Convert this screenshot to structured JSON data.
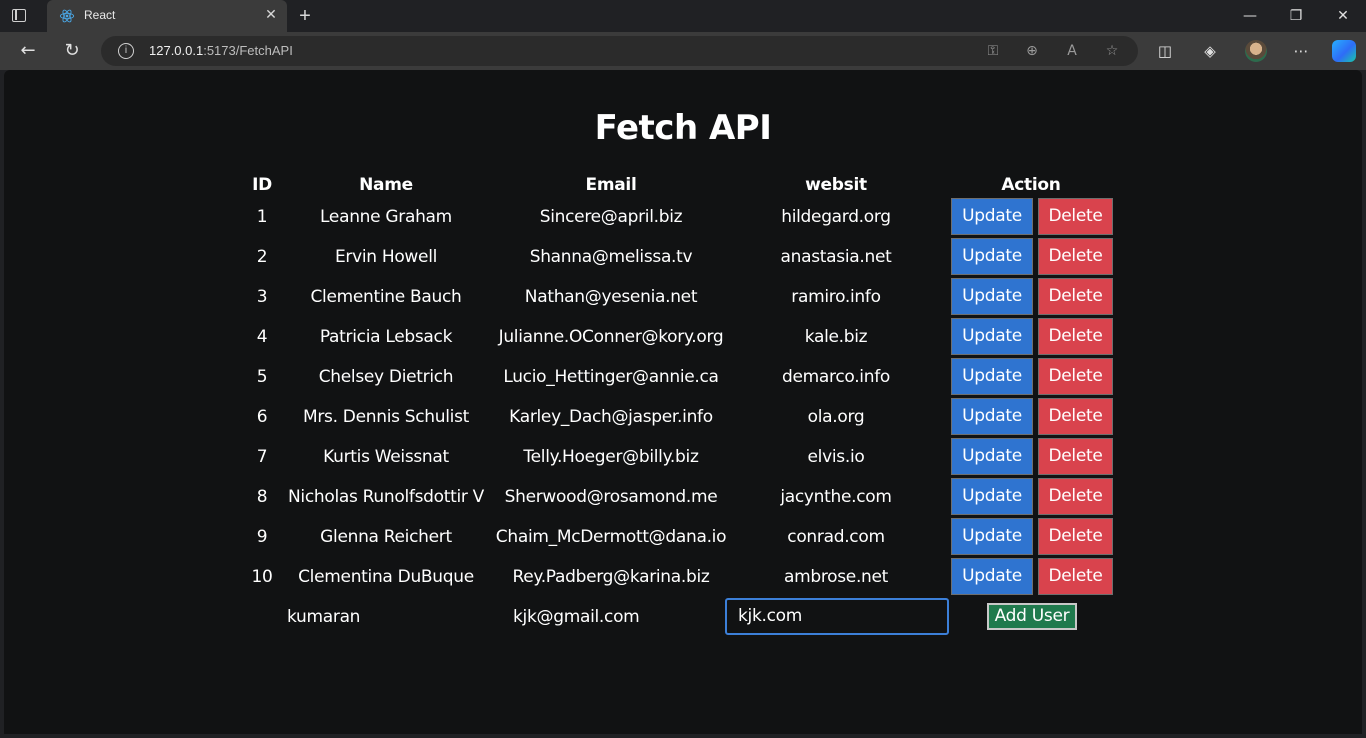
{
  "browser": {
    "tab_title": "React",
    "url_host": "127.0.0.1",
    "url_rest": ":5173/FetchAPI"
  },
  "page": {
    "title": "Fetch API",
    "headers": [
      "ID",
      "Name",
      "Email",
      "websit",
      "Action"
    ],
    "rows": [
      {
        "id": "1",
        "name": "Leanne Graham",
        "email": "Sincere@april.biz",
        "website": "hildegard.org"
      },
      {
        "id": "2",
        "name": "Ervin Howell",
        "email": "Shanna@melissa.tv",
        "website": "anastasia.net"
      },
      {
        "id": "3",
        "name": "Clementine Bauch",
        "email": "Nathan@yesenia.net",
        "website": "ramiro.info"
      },
      {
        "id": "4",
        "name": "Patricia Lebsack",
        "email": "Julianne.OConner@kory.org",
        "website": "kale.biz"
      },
      {
        "id": "5",
        "name": "Chelsey Dietrich",
        "email": "Lucio_Hettinger@annie.ca",
        "website": "demarco.info"
      },
      {
        "id": "6",
        "name": "Mrs. Dennis Schulist",
        "email": "Karley_Dach@jasper.info",
        "website": "ola.org"
      },
      {
        "id": "7",
        "name": "Kurtis Weissnat",
        "email": "Telly.Hoeger@billy.biz",
        "website": "elvis.io"
      },
      {
        "id": "8",
        "name": "Nicholas Runolfsdottir V",
        "email": "Sherwood@rosamond.me",
        "website": "jacynthe.com"
      },
      {
        "id": "9",
        "name": "Glenna Reichert",
        "email": "Chaim_McDermott@dana.io",
        "website": "conrad.com"
      },
      {
        "id": "10",
        "name": "Clementina DuBuque",
        "email": "Rey.Padberg@karina.biz",
        "website": "ambrose.net"
      }
    ],
    "update_label": "Update",
    "delete_label": "Delete",
    "new_user": {
      "name": "kumaran",
      "email": "kjk@gmail.com",
      "website": "kjk.com",
      "add_label": "Add User"
    }
  },
  "colors": {
    "update": "#2f74d0",
    "delete": "#d9434d",
    "add": "#1f7a4d",
    "background": "#111213"
  }
}
